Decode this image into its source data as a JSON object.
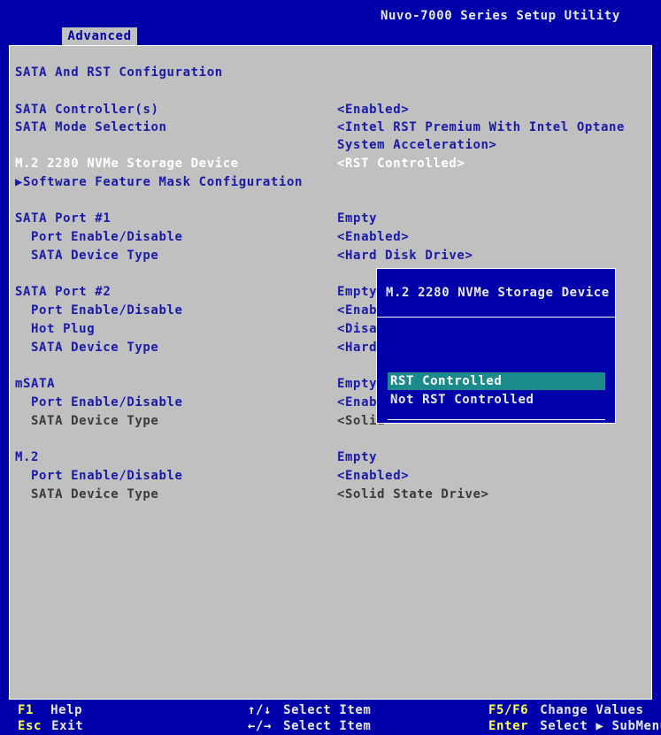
{
  "app": {
    "title": "Nuvo-7000 Series Setup Utility",
    "tab": "Advanced"
  },
  "page": {
    "heading": "SATA And RST Configuration",
    "items": [
      {
        "label": "SATA Controller(s)",
        "value": "<Enabled>"
      },
      {
        "label": "SATA Mode Selection",
        "value": "<Intel RST Premium With Intel Optane",
        "value2": "System Acceleration>"
      },
      {
        "label": "M.2 2280 NVMe Storage Device",
        "value": "<RST Controlled>"
      },
      {
        "label": "▶Software Feature Mask Configuration"
      },
      {
        "label": "SATA Port #1",
        "value": "Empty"
      },
      {
        "label": "Port Enable/Disable",
        "value": "<Enabled>"
      },
      {
        "label": "SATA Device Type",
        "value": "<Hard Disk Drive>"
      },
      {
        "label": "SATA Port #2",
        "value": "Empty"
      },
      {
        "label": "Port Enable/Disable",
        "value": "<Enabled>"
      },
      {
        "label": "Hot Plug",
        "value": "<Disab"
      },
      {
        "label": "SATA Device Type",
        "value": "<Hard"
      },
      {
        "label": "mSATA",
        "value": "Empty"
      },
      {
        "label": "Port Enable/Disable",
        "value": "<Enabl"
      },
      {
        "label": "SATA Device Type",
        "value": "<Solid"
      },
      {
        "label": "M.2",
        "value": "Empty"
      },
      {
        "label": "Port Enable/Disable",
        "value": "<Enabled>"
      },
      {
        "label": "SATA Device Type",
        "value": "<Solid State Drive>"
      }
    ]
  },
  "popup": {
    "title": "M.2 2280 NVMe Storage Device",
    "options": [
      "RST Controlled",
      "Not RST Controlled"
    ],
    "selected": 0
  },
  "footer": {
    "f1_key": "F1",
    "f1_label": "Help",
    "esc_key": "Esc",
    "esc_label": "Exit",
    "updown_key": "↑/↓",
    "updown_label": "Select Item",
    "leftright_key": "←/→",
    "leftright_label": "Select Item",
    "f5f6_key": "F5/F6",
    "f5f6_label": "Change Values",
    "enter_key": "Enter",
    "enter_label": "Select ▶ SubMenu"
  },
  "colors": {
    "background": "#0000aa",
    "panel": "#c0c0c0",
    "highlight": "#1a8a8a",
    "hotkey": "#ffff55"
  }
}
